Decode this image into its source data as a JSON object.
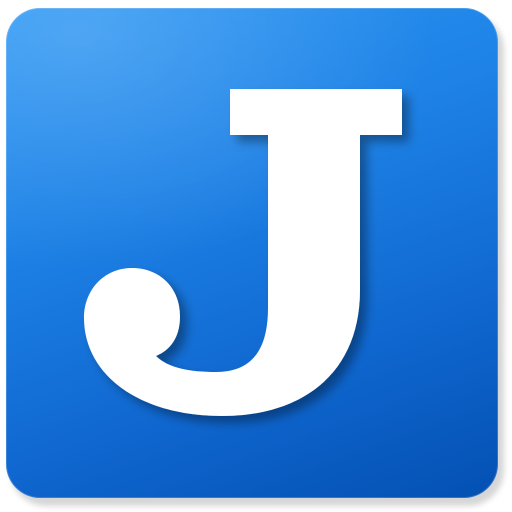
{
  "icon": {
    "name": "joplin-app-icon",
    "letter": "J",
    "colors": {
      "tile_top": "#2a96f4",
      "tile_bottom": "#0450b3",
      "letter": "#ffffff"
    }
  }
}
